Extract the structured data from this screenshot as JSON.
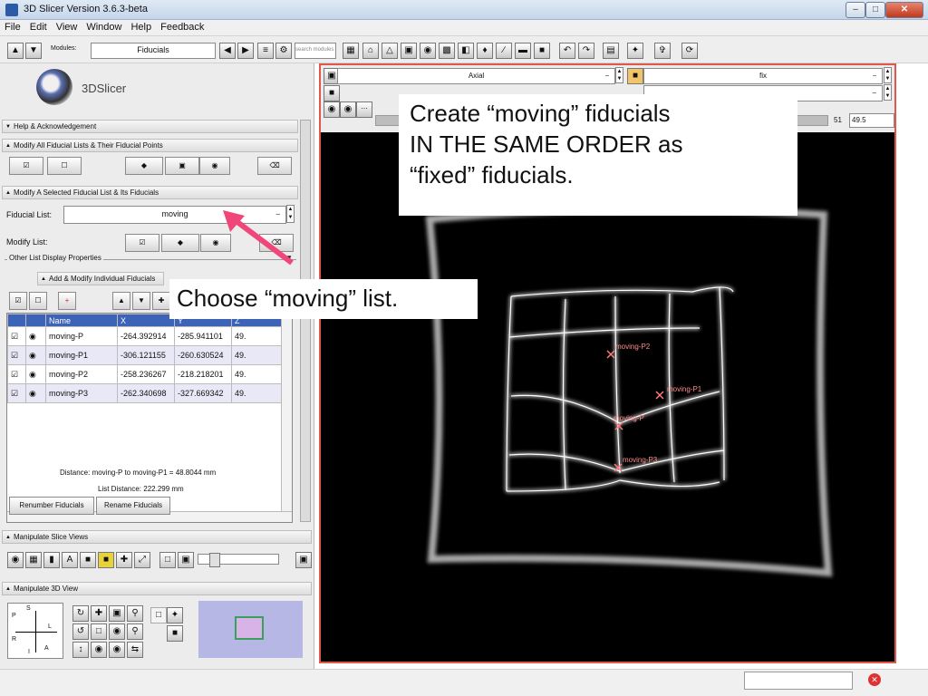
{
  "window": {
    "title": "3D Slicer Version 3.6.3-beta"
  },
  "menu": [
    "File",
    "Edit",
    "View",
    "Window",
    "Help",
    "Feedback"
  ],
  "toolbar": {
    "modules_label": "Modules:",
    "module_value": "Fiducials",
    "search_placeholder": "search modules"
  },
  "logo": {
    "text": "3DSlicer"
  },
  "panels": {
    "help": "Help & Acknowledgement",
    "modify_all": "Modify All Fiducial Lists & Their Fiducial Points",
    "modify_selected": "Modify A Selected Fiducial List & Its Fiducials",
    "fiducial_list_label": "Fiducial List:",
    "fiducial_list_value": "moving",
    "modify_list_label": "Modify List:",
    "other_props": "Other List Display Properties",
    "add_modify": "Add & Modify Individual Fiducials"
  },
  "table": {
    "headers": [
      "Name",
      "X",
      "Y",
      "Z"
    ],
    "rows": [
      {
        "name": "moving-P",
        "x": "-264.392914",
        "y": "-285.941101",
        "z": "49."
      },
      {
        "name": "moving-P1",
        "x": "-306.121155",
        "y": "-260.630524",
        "z": "49."
      },
      {
        "name": "moving-P2",
        "x": "-258.236267",
        "y": "-218.218201",
        "z": "49."
      },
      {
        "name": "moving-P3",
        "x": "-262.340698",
        "y": "-327.669342",
        "z": "49."
      }
    ]
  },
  "distance_text": "Distance: moving-P to moving-P1 = 48.8044 mm",
  "list_distance_text": "List Distance: 222.299 mm",
  "buttons": {
    "renumber": "Renumber Fiducials",
    "rename": "Rename Fiducials"
  },
  "slice_section": "Manipulate Slice Views",
  "view3d_section": "Manipulate 3D View",
  "orientation": {
    "s": "S",
    "p": "P",
    "r": "R",
    "l": "L",
    "i": "I",
    "a": "A"
  },
  "viewer": {
    "orientation_select": "Axial",
    "volume_select": "fix",
    "slice_number": "51",
    "slice_value": "49.5",
    "labels": [
      "moving-P2",
      "moving-P1",
      "moving-P",
      "moving-P3"
    ]
  },
  "callouts": {
    "top": [
      "Create “moving” fiducials",
      "IN THE SAME ORDER as",
      "“fixed” fiducials."
    ],
    "mid": "Choose “moving” list."
  },
  "colors": {
    "accent": "#3d63b8",
    "viewer_border": "#e0574b",
    "arrow": "#f0467a"
  }
}
